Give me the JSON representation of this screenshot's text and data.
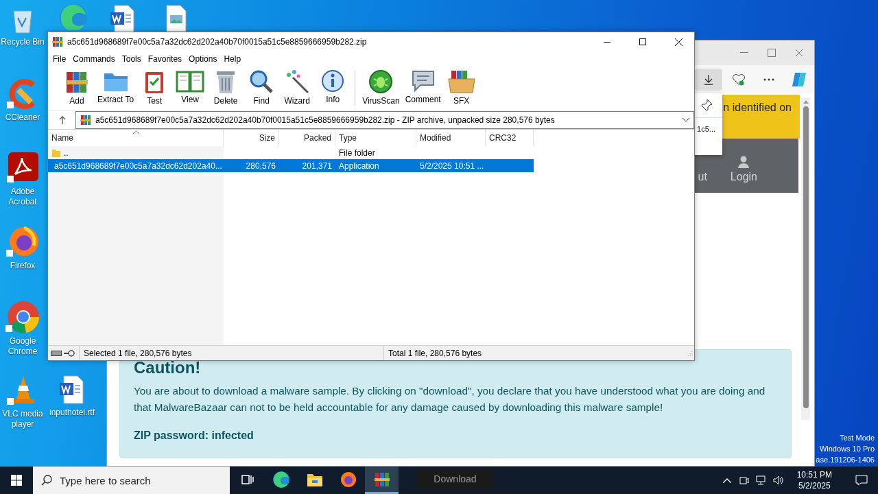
{
  "desktop_icons": [
    {
      "kind": "recycle",
      "label": "Recycle Bin"
    },
    {
      "kind": "edge"
    },
    {
      "kind": "word"
    },
    {
      "kind": "image"
    },
    {
      "kind": "ccleaner",
      "label": "CCleaner"
    },
    {
      "kind": "acrobat",
      "label": "Adobe Acrobat"
    },
    {
      "kind": "firefox",
      "label": "Firefox"
    },
    {
      "kind": "chrome",
      "label": "Google Chrome"
    },
    {
      "kind": "vlc",
      "label": "VLC media player"
    },
    {
      "kind": "word",
      "label": "inputhotel.rtf"
    }
  ],
  "system_notice": [
    "Test Mode",
    "Windows 10 Pro",
    "ase.191206-1406"
  ],
  "browser": {
    "download_panel": {
      "file": "1c5..."
    },
    "banner": "n identified on",
    "nav": [
      {
        "kind": "text",
        "label": "ut"
      },
      {
        "kind": "user",
        "label": "Login"
      }
    ],
    "caution": {
      "title": "Caution!",
      "text": "You are about to download a malware sample. By clicking on \"download\", you declare that you have understood what you are doing and that MalwareBazaar can not to be held accountable for any damage caused by downloading this malware sample!",
      "password": "ZIP password: infected"
    },
    "download_button": "Download"
  },
  "winrar": {
    "title": "a5c651d968689f7e00c5a7a32dc62d202a40b70f0015a51c5e8859666959b282.zip",
    "menu": [
      "File",
      "Commands",
      "Tools",
      "Favorites",
      "Options",
      "Help"
    ],
    "toolbar": [
      [
        {
          "kind": "add",
          "label": "Add"
        },
        {
          "kind": "extract",
          "label": "Extract To"
        },
        {
          "kind": "test",
          "label": "Test"
        },
        {
          "kind": "view",
          "label": "View"
        },
        {
          "kind": "delete",
          "label": "Delete"
        },
        {
          "kind": "find",
          "label": "Find"
        },
        {
          "kind": "wizard",
          "label": "Wizard"
        },
        {
          "kind": "info",
          "label": "Info"
        }
      ],
      [
        {
          "kind": "virusscan",
          "label": "VirusScan"
        },
        {
          "kind": "comment",
          "label": "Comment"
        },
        {
          "kind": "sfx",
          "label": "SFX"
        }
      ]
    ],
    "path": "a5c651d968689f7e00c5a7a32dc62d202a40b70f0015a51c5e8859666959b282.zip - ZIP archive, unpacked size 280,576 bytes",
    "columns": [
      "Name",
      "Size",
      "Packed",
      "Type",
      "Modified",
      "CRC32"
    ],
    "rows": [
      {
        "kind": "folder",
        "name": "..",
        "type": "File folder",
        "selected": false
      },
      {
        "kind": "file",
        "name": "a5c651d968689f7e00c5a7a32dc62d202a40...",
        "size": "280,576",
        "packed": "201,371",
        "type": "Application",
        "modified": "5/2/2025 10:51 ...",
        "selected": true
      }
    ],
    "status_left": "Selected 1 file, 280,576 bytes",
    "status_right": "Total 1 file, 280,576 bytes"
  },
  "taskbar": {
    "search_placeholder": "Type here to search",
    "apps": [
      {
        "kind": "taskview",
        "selected": false
      },
      {
        "kind": "edge",
        "selected": false
      },
      {
        "kind": "explorer",
        "selected": false
      },
      {
        "kind": "firefox",
        "selected": false
      },
      {
        "kind": "winrar",
        "selected": true
      }
    ],
    "time": "10:51 PM",
    "date": "5/2/2025"
  }
}
